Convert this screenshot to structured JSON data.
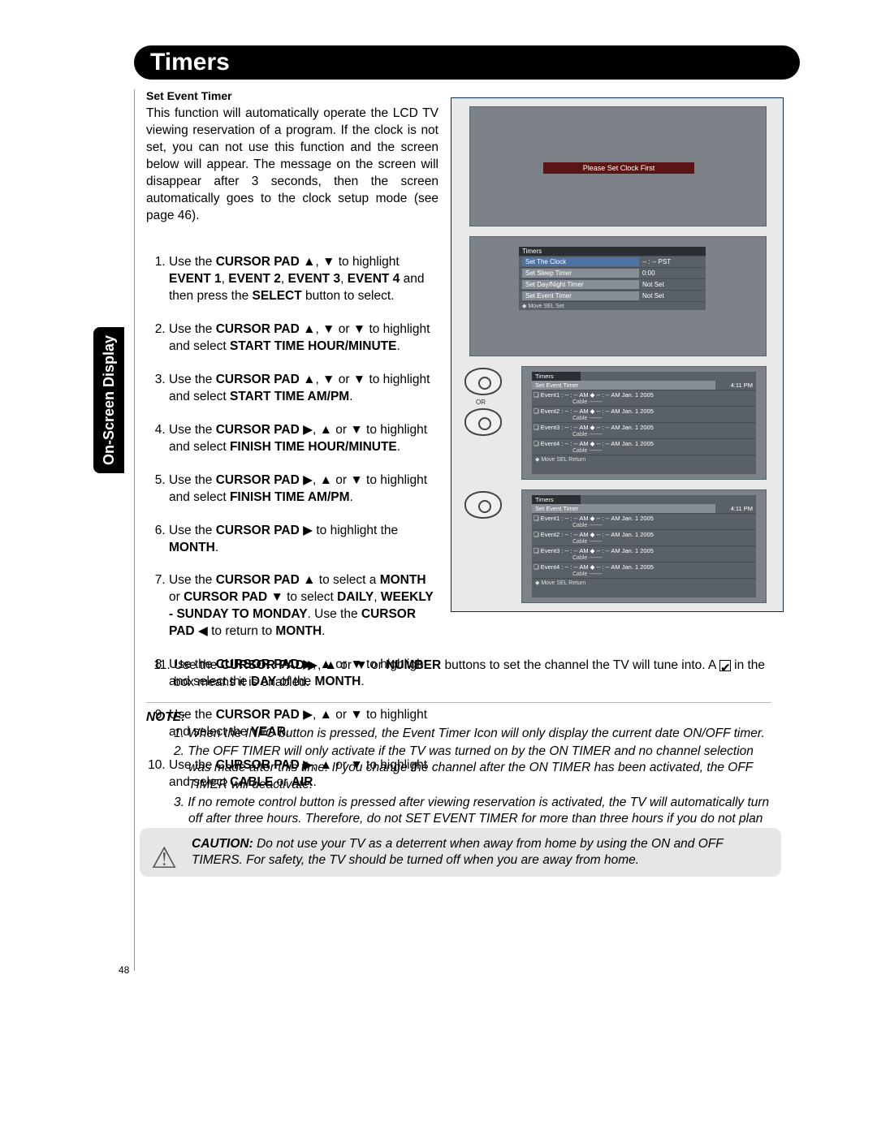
{
  "header": {
    "title": "Timers"
  },
  "sidetab": {
    "label": "On-Screen Display"
  },
  "section": {
    "heading": "Set Event Timer",
    "intro": "This function will automatically operate the LCD TV viewing reservation of a program. If the clock is not set, you can not use this function and the screen below will appear. The message on the screen will disappear after 3 seconds, then the screen automatically goes to the clock setup mode (see page 46)."
  },
  "steps": {
    "s1a": "Use the ",
    "s1b": "CURSOR PAD",
    "s1c": " to highlight ",
    "s1d": "EVENT 1",
    "s1e": "EVENT 2",
    "s1f": "EVENT 3",
    "s1g": "EVENT 4",
    "s1h": " and then press the ",
    "s1i": "SELECT",
    "s1j": " button to select.",
    "s2a": "Use the ",
    "s2b": "CURSOR PAD",
    "s2c": " to highlight and select ",
    "s2d": "START TIME HOUR/MINUTE",
    "s3a": "Use the ",
    "s3b": "CURSOR PAD",
    "s3c": " to highlight and select ",
    "s3d": "START TIME AM/PM",
    "s4a": "Use the ",
    "s4b": "CURSOR PAD",
    "s4c": " to highlight and select ",
    "s4d": "FINISH TIME HOUR/MINUTE",
    "s5a": "Use the ",
    "s5b": "CURSOR PAD",
    "s5c": " to highlight and select ",
    "s5d": "FINISH TIME AM/PM",
    "s6a": "Use the ",
    "s6b": "CURSOR PAD",
    "s6c": " to highlight the ",
    "s6d": "MONTH",
    "s7a": "Use the ",
    "s7b": "CURSOR PAD",
    "s7c": " to select a ",
    "s7d": "MONTH",
    "s7e": " or ",
    "s7f": "CURSOR PAD",
    "s7g": " to select ",
    "s7h": "DAILY",
    "s7i": "WEEKLY - SUNDAY TO MONDAY",
    "s7j": ". Use the ",
    "s7k": "CURSOR PAD",
    "s7l": " to return to ",
    "s7m": "MONTH",
    "s8a": "Use the ",
    "s8b": "CURSOR PAD",
    "s8c": " to highlight and select the ",
    "s8d": "DAY",
    "s8e": " of the ",
    "s8f": "MONTH",
    "s9a": "Use the ",
    "s9b": "CURSOR PAD",
    "s9c": " to highlight and select the ",
    "s9d": "YEAR",
    "s10a": "Use the ",
    "s10b": "CURSOR PAD",
    "s10c": " to highlight and select ",
    "s10d": "CABLE",
    "s10e": " or ",
    "s10f": "AIR",
    "s11a": "Use the ",
    "s11b": "CURSOR PAD",
    "s11c": " or ",
    "s11d": "NUMBER",
    "s11e": " buttons to set the channel the TV will tune into. A ",
    "s11f": " in the box means it is enabled."
  },
  "notes": {
    "label": "NOTE:",
    "n1": "1. When the INFO button is pressed, the Event Timer Icon will only display the current date ON/OFF timer.",
    "n2": "2. The OFF TIMER will only activate if the TV was turned on by the ON TIMER and no channel selection was made after this time. If you change the channel after the ON TIMER has been activated, the OFF TIMER will deactivate.",
    "n3": "3. If no remote control button is pressed after viewing reservation is activated, the TV will automatically turn off after three hours. Therefore, do not SET EVENT TIMER for more than three hours if you do not plan to control your television with the remote control."
  },
  "caution": {
    "label": "CAUTION:",
    "body": " Do not use your TV as a deterrent when away from home by using the ON and OFF TIMERS. For safety, the TV should be turned off when you are away from home."
  },
  "page": "48",
  "screens": {
    "clockmsg": "Please Set Clock First",
    "menu": {
      "title": "Timers",
      "rows": [
        {
          "l": "Set The Clock",
          "r": "-- : --  PST"
        },
        {
          "l": "Set Sleep Timer",
          "r": "0:00"
        },
        {
          "l": "Set Day/Night Timer",
          "r": "Not Set"
        },
        {
          "l": "Set Event Timer",
          "r": "Not Set"
        }
      ],
      "foot": "◆ Move   SEL Set"
    },
    "evt": {
      "title1": "Timers",
      "title2": "Set Event Timer",
      "time": "4:11 PM",
      "rows": [
        "❏ Event1   :    -- : -- AM  ◆  -- : -- AM    Jan. 1 2005",
        "❏ Event2   :    -- : -- AM  ◆  -- : -- AM    Jan. 1 2005",
        "❏ Event3   :    -- : -- AM  ◆  -- : -- AM    Jan. 1 2005",
        "❏ Event4   :    -- : -- AM  ◆  -- : -- AM    Jan. 1 2005"
      ],
      "sub": "Cable     -------",
      "foot": "◆ Move     SEL Return"
    },
    "or": "OR"
  }
}
